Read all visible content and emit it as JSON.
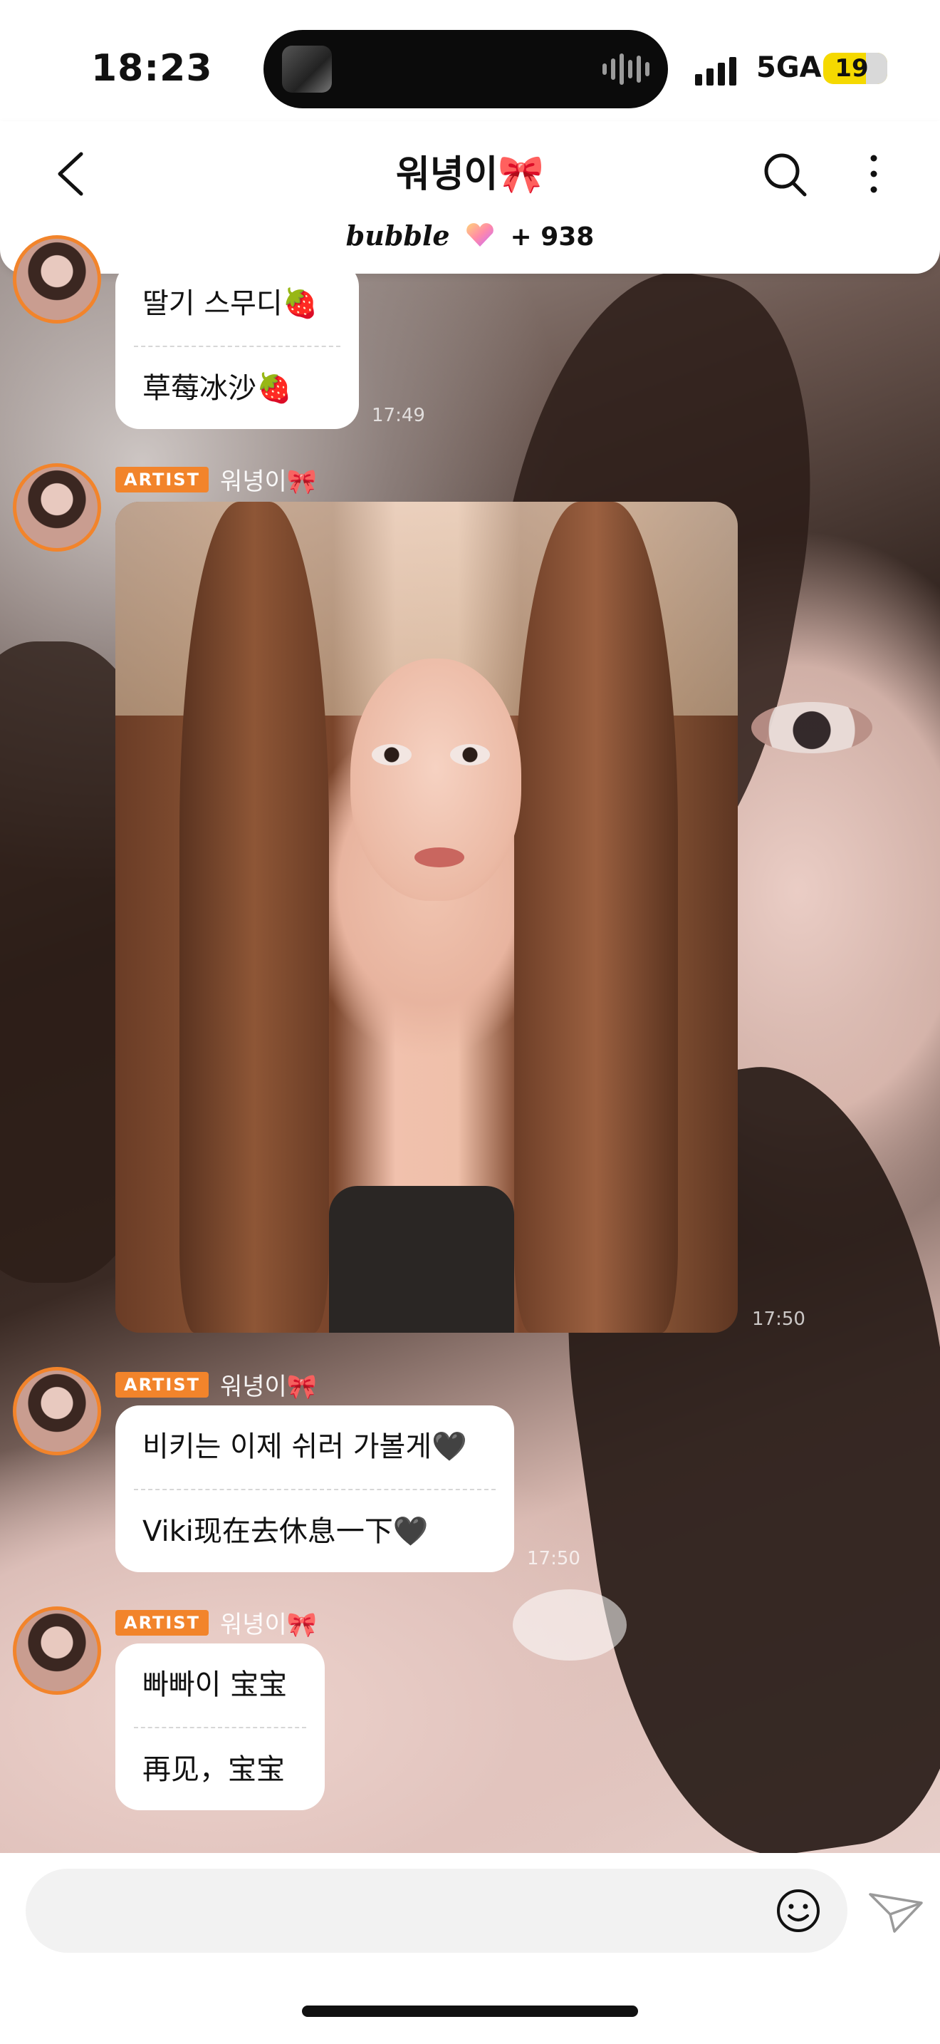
{
  "status_bar": {
    "time": "18:23",
    "network": "5GA",
    "battery": "19",
    "battery_level": 0.19
  },
  "header": {
    "title": "워녕이🎀",
    "bubble_label": "bubble",
    "bubble_count": "+ 938"
  },
  "messages": [
    {
      "type": "text",
      "lines": [
        "딸기 스무디🍓",
        "草莓冰沙🍓"
      ],
      "time": "17:49"
    },
    {
      "type": "image",
      "badge": "ARTIST",
      "sender": "워녕이🎀",
      "time": "17:50"
    },
    {
      "type": "text",
      "badge": "ARTIST",
      "sender": "워녕이🎀",
      "lines": [
        "비키는 이제 쉬러 가볼게🖤",
        "Viki现在去休息一下🖤"
      ],
      "time": "17:50"
    },
    {
      "type": "text",
      "badge": "ARTIST",
      "sender": "워녕이🎀",
      "lines": [
        "빠빠이 宝宝",
        "再见，宝宝"
      ]
    }
  ],
  "icons": {
    "back": "chevron-left-icon",
    "search": "search-icon",
    "more": "more-vertical-icon",
    "emoji": "smile-icon",
    "send": "send-icon",
    "heart": "heart-gem-icon"
  },
  "colors": {
    "accent": "#f2842b",
    "bubble": "#ffffff",
    "battery": "#f5d900"
  }
}
